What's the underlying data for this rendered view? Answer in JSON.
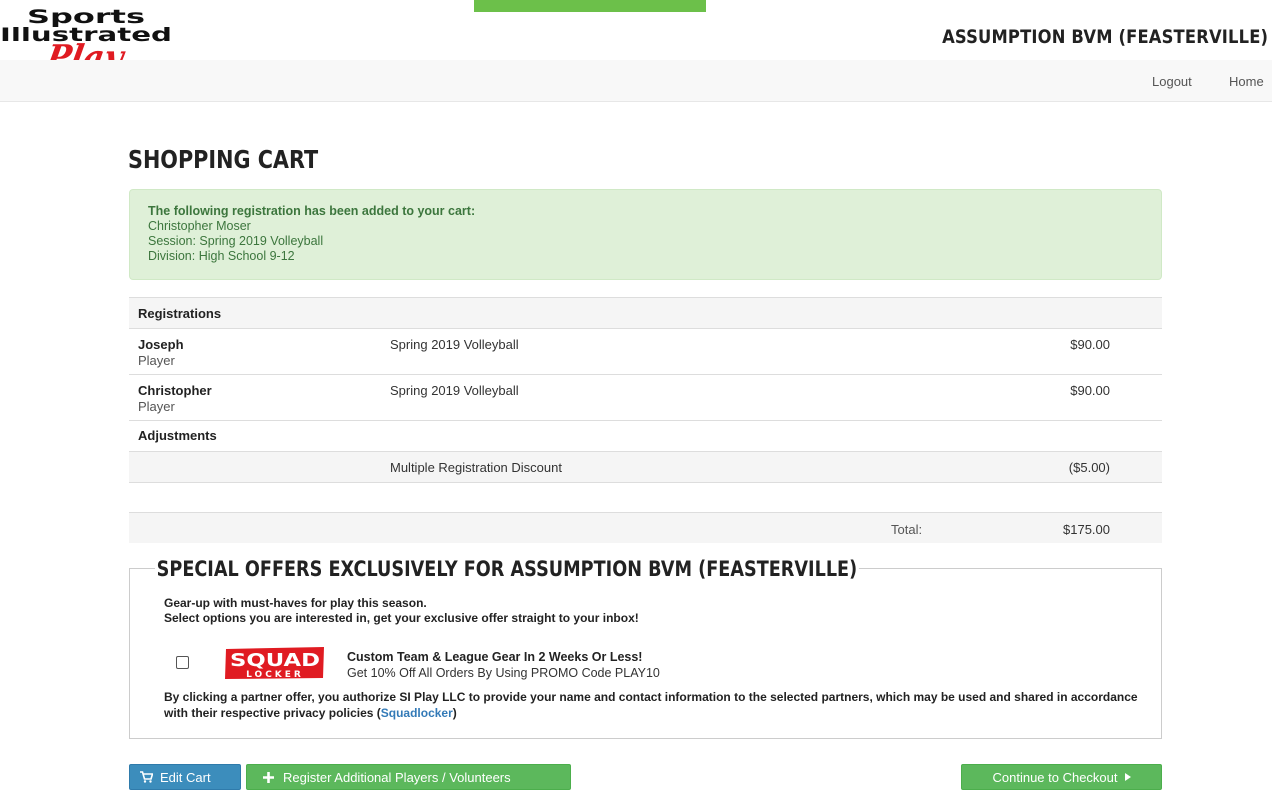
{
  "header": {
    "logo_text": [
      "Sports",
      "Illustrated",
      "Play"
    ],
    "site_title": "ASSUMPTION BVM (FEASTERVILLE)"
  },
  "nav": {
    "logout": "Logout",
    "home": "Home"
  },
  "page_title": "SHOPPING CART",
  "alert": {
    "heading": "The following registration has been added to your cart:",
    "name": "Christopher Moser",
    "session": "Session: Spring 2019 Volleyball",
    "division": "Division: High School 9-12"
  },
  "cart": {
    "registrations_header": "Registrations",
    "registrations": [
      {
        "name": "Joseph",
        "role": "Player",
        "session": "Spring 2019 Volleyball",
        "amount": "$90.00"
      },
      {
        "name": "Christopher",
        "role": "Player",
        "session": "Spring 2019 Volleyball",
        "amount": "$90.00"
      }
    ],
    "adjustments_header": "Adjustments",
    "adjustments": [
      {
        "description": "Multiple Registration Discount",
        "amount": "($5.00)"
      }
    ],
    "total_label": "Total:",
    "total_value": "$175.00"
  },
  "offers": {
    "title": "SPECIAL OFFERS EXCLUSIVELY FOR ASSUMPTION BVM (FEASTERVILLE)",
    "intro_line1": "Gear-up with must-haves for play this season.",
    "intro_line2": "Select options you are interested in, get your exclusive offer straight to your inbox!",
    "partner": {
      "logo_line1": "SQUAD",
      "logo_line2": "LOCKER",
      "headline": "Custom Team & League Gear In 2 Weeks Or Less!",
      "promo": "Get 10% Off All Orders By Using PROMO Code PLAY10",
      "checked": false
    },
    "consent_text": "By clicking a partner offer, you authorize SI Play LLC to provide your name and contact information to the selected partners, which may be used and shared in accordance with their respective privacy policies (",
    "consent_link": "Squadlocker",
    "consent_end": ")"
  },
  "buttons": {
    "edit_cart": "Edit Cart",
    "register_additional": "Register Additional Players / Volunteers",
    "continue_checkout": "Continue to Checkout"
  },
  "colors": {
    "primary_blue": "#3c8dbc",
    "success_green": "#5cb85c",
    "alert_bg": "#dff0d8",
    "alert_text": "#3c763d",
    "link_blue": "#337ab7",
    "logo_red": "#e01b22"
  }
}
